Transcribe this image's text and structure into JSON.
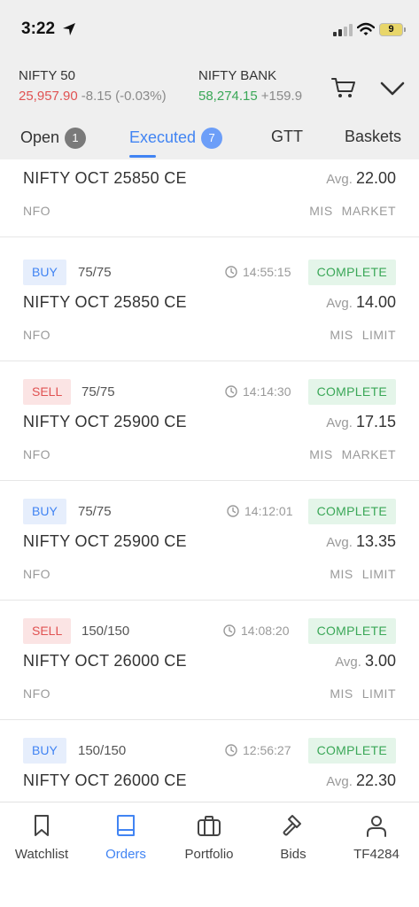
{
  "status_bar": {
    "time": "3:22",
    "battery": "9"
  },
  "ticker": {
    "index1": {
      "name": "NIFTY 50",
      "price": "25,957.90",
      "change": "-8.15 (-0.03%)"
    },
    "index2": {
      "name": "NIFTY BANK",
      "price": "58,274.15",
      "change": "+159.9"
    }
  },
  "tabs": {
    "open": {
      "label": "Open",
      "count": "1"
    },
    "executed": {
      "label": "Executed",
      "count": "7"
    },
    "gtt": {
      "label": "GTT"
    },
    "baskets": {
      "label": "Baskets"
    }
  },
  "orders": [
    {
      "instrument": "NIFTY OCT 25850 CE",
      "avg_label": "Avg.",
      "avg": "22.00",
      "exchange": "NFO",
      "product": "MIS",
      "order_type": "MARKET"
    },
    {
      "side": "BUY",
      "qty": "75/75",
      "time": "14:55:15",
      "status": "COMPLETE",
      "instrument": "NIFTY OCT 25850 CE",
      "avg_label": "Avg.",
      "avg": "14.00",
      "exchange": "NFO",
      "product": "MIS",
      "order_type": "LIMIT"
    },
    {
      "side": "SELL",
      "qty": "75/75",
      "time": "14:14:30",
      "status": "COMPLETE",
      "instrument": "NIFTY OCT 25900 CE",
      "avg_label": "Avg.",
      "avg": "17.15",
      "exchange": "NFO",
      "product": "MIS",
      "order_type": "MARKET"
    },
    {
      "side": "BUY",
      "qty": "75/75",
      "time": "14:12:01",
      "status": "COMPLETE",
      "instrument": "NIFTY OCT 25900 CE",
      "avg_label": "Avg.",
      "avg": "13.35",
      "exchange": "NFO",
      "product": "MIS",
      "order_type": "LIMIT"
    },
    {
      "side": "SELL",
      "qty": "150/150",
      "time": "14:08:20",
      "status": "COMPLETE",
      "instrument": "NIFTY OCT 26000 CE",
      "avg_label": "Avg.",
      "avg": "3.00",
      "exchange": "NFO",
      "product": "MIS",
      "order_type": "LIMIT"
    },
    {
      "side": "BUY",
      "qty": "150/150",
      "time": "12:56:27",
      "status": "COMPLETE",
      "instrument": "NIFTY OCT 26000 CE",
      "avg_label": "Avg.",
      "avg": "22.30"
    }
  ],
  "bottom_nav": {
    "watchlist": "Watchlist",
    "orders": "Orders",
    "portfolio": "Portfolio",
    "bids": "Bids",
    "account": "TF4284"
  },
  "colors": {
    "accent": "#4184f3",
    "buy": "#4184f3",
    "sell": "#e05252",
    "complete": "#3aa757"
  }
}
